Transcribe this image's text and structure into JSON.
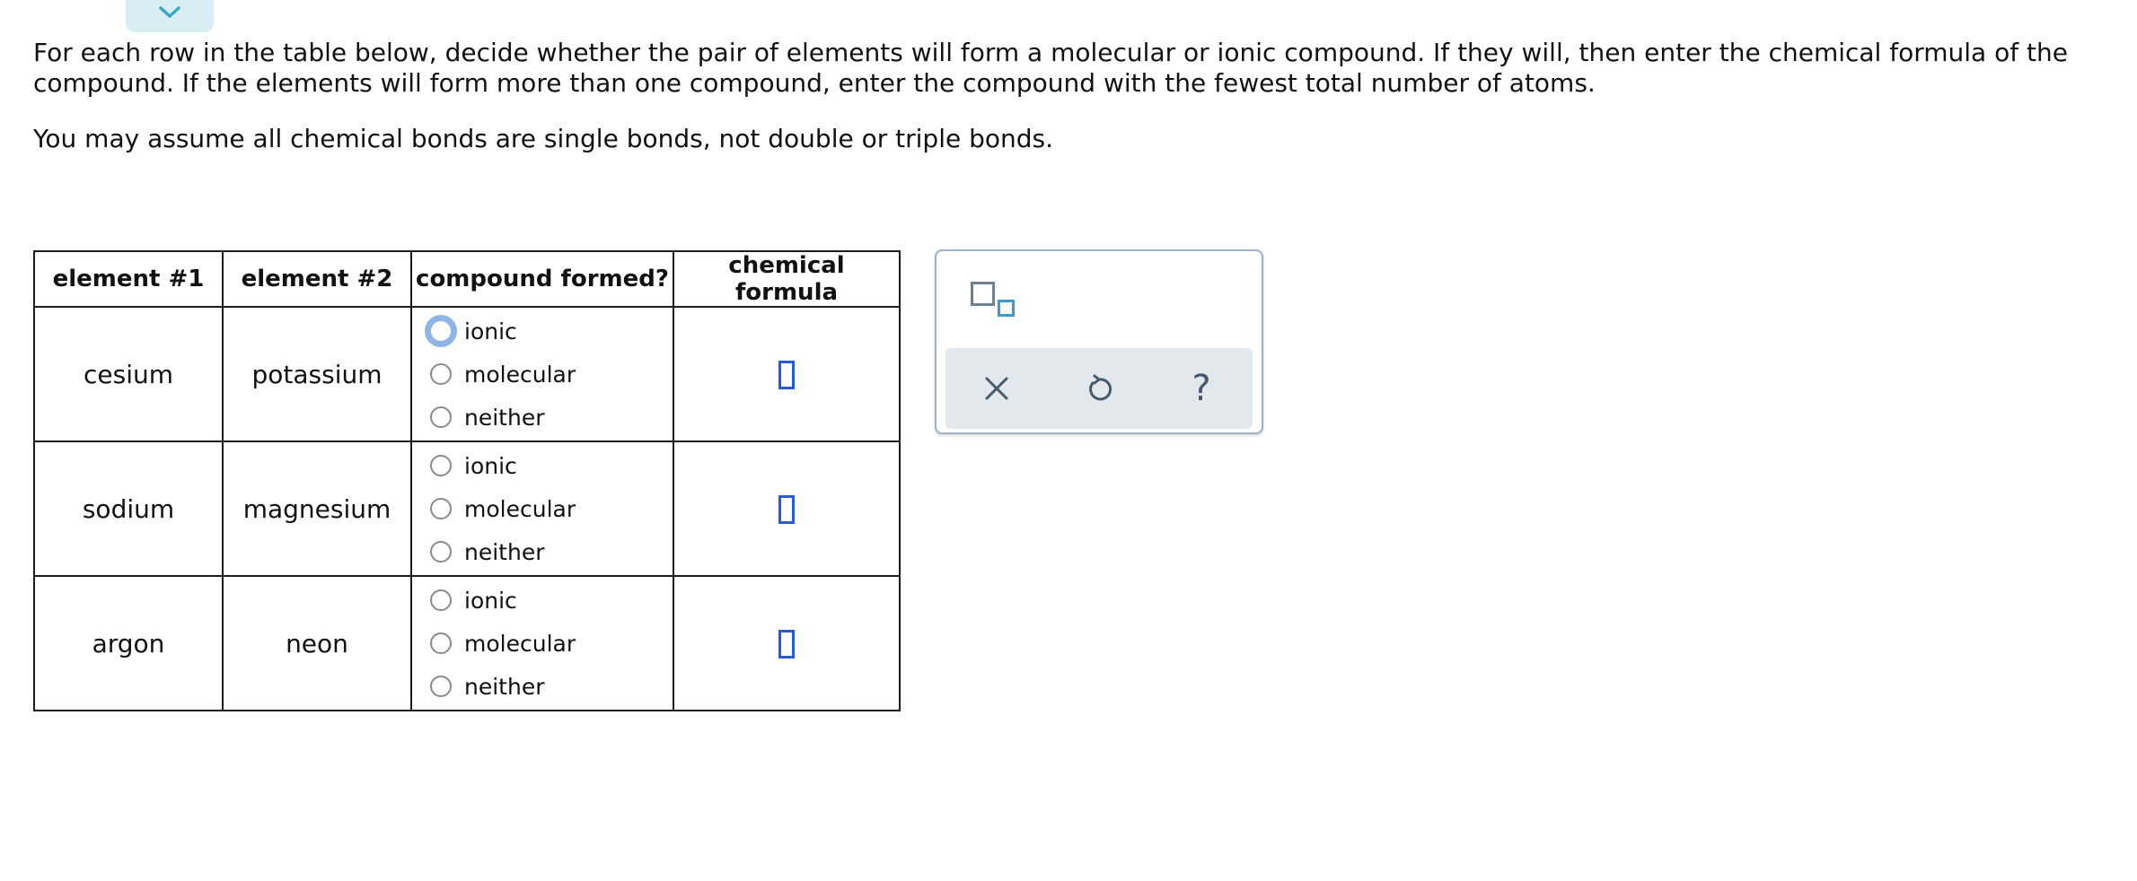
{
  "instructions": {
    "p1": "For each row in the table below, decide whether the pair of elements will form a molecular or ionic compound. If they will, then enter the chemical formula of the compound. If the elements will form more than one compound, enter the compound with the fewest total number of atoms.",
    "p2": "You may assume all chemical bonds are single bonds, not double or triple bonds."
  },
  "table": {
    "headers": [
      "element #1",
      "element #2",
      "compound formed?",
      "chemical formula"
    ],
    "rows": [
      {
        "element1": "cesium",
        "element2": "potassium",
        "options": [
          "ionic",
          "molecular",
          "neither"
        ]
      },
      {
        "element1": "sodium",
        "element2": "magnesium",
        "options": [
          "ionic",
          "molecular",
          "neither"
        ]
      },
      {
        "element1": "argon",
        "element2": "neon",
        "options": [
          "ionic",
          "molecular",
          "neither"
        ]
      }
    ]
  },
  "toolbar": {
    "icons": [
      "superscript-template-icon",
      "clear-icon",
      "undo-icon",
      "help-icon"
    ],
    "help_label": "?"
  },
  "colors": {
    "accent_blue": "#2a5bd7",
    "focus_ring": "#8fb4e6",
    "collapse_tab": "#d9eef3",
    "toolbar_bg": "#e3e8ec"
  }
}
